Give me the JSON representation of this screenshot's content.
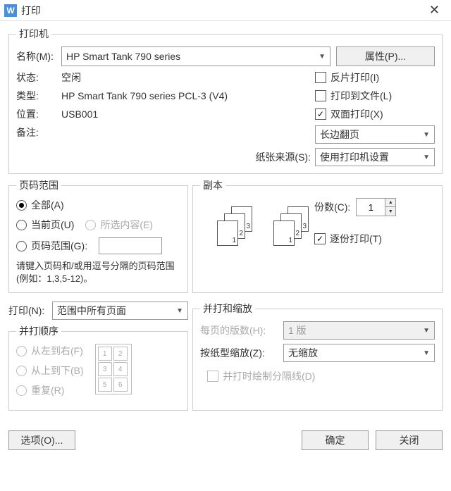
{
  "titlebar": {
    "title": "打印"
  },
  "printer": {
    "legend": "打印机",
    "name_label": "名称(M):",
    "name_value": "HP Smart Tank 790 series",
    "properties_btn": "属性(P)...",
    "status_label": "状态:",
    "status_value": "空闲",
    "type_label": "类型:",
    "type_value": "HP Smart Tank 790 series PCL-3 (V4)",
    "where_label": "位置:",
    "where_value": "USB001",
    "comment_label": "备注:",
    "reverse_label": "反片打印(I)",
    "tofile_label": "打印到文件(L)",
    "duplex_label": "双面打印(X)",
    "flip_value": "长边翻页",
    "source_label": "纸张来源(S):",
    "source_value": "使用打印机设置"
  },
  "range": {
    "legend": "页码范围",
    "all": "全部(A)",
    "current": "当前页(U)",
    "selection": "所选内容(E)",
    "pages": "页码范围(G):",
    "help": "请键入页码和/或用逗号分隔的页码范围(例如：1,3,5-12)。"
  },
  "copies": {
    "legend": "副本",
    "count_label": "份数(C):",
    "count_value": "1",
    "collate_label": "逐份打印(T)"
  },
  "print_what": {
    "label": "打印(N):",
    "value": "范围中所有页面"
  },
  "merge": {
    "legend": "并打和缩放",
    "pages_per_label": "每页的版数(H):",
    "pages_per_value": "1 版",
    "scale_label": "按纸型缩放(Z):",
    "scale_value": "无缩放",
    "draw_sep": "并打时绘制分隔线(D)"
  },
  "order": {
    "legend": "并打顺序",
    "ltr": "从左到右(F)",
    "ttb": "从上到下(B)",
    "repeat": "重复(R)"
  },
  "footer": {
    "options": "选项(O)...",
    "ok": "确定",
    "close": "关闭"
  }
}
